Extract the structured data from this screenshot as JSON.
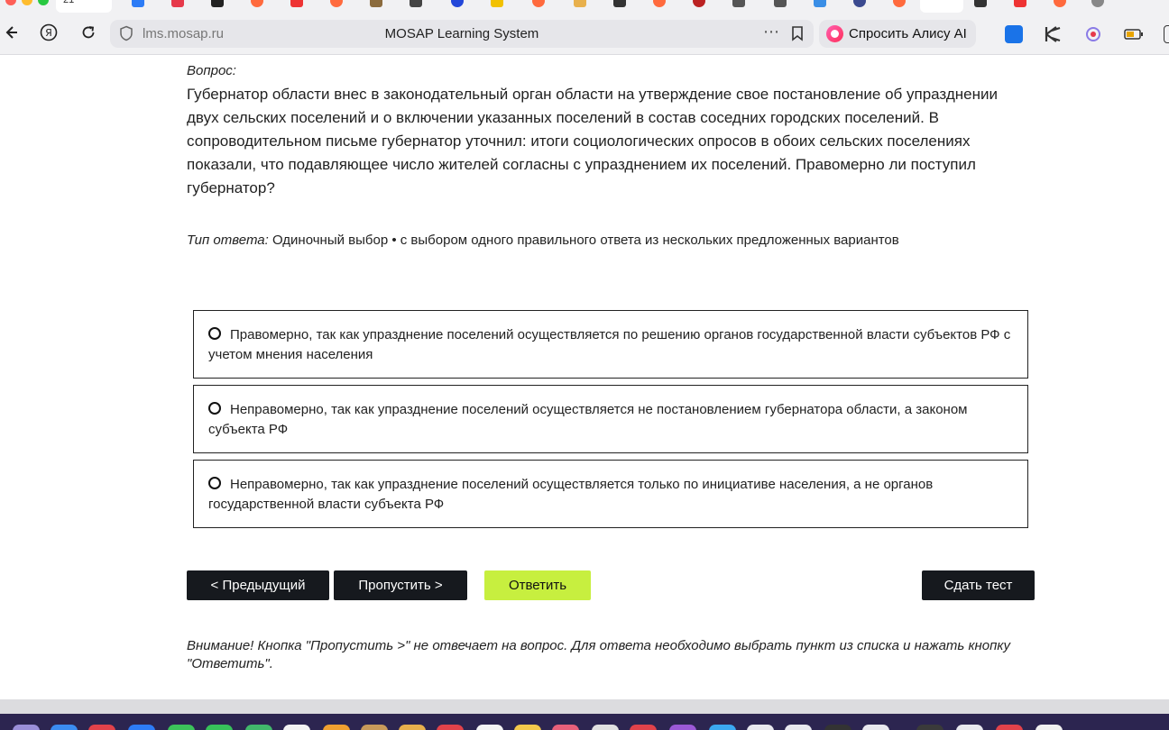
{
  "browser": {
    "url": "lms.mosap.ru",
    "page_title": "MOSAP Learning System",
    "alice_button_label": "Спросить Алису AI",
    "more_icon": "⋯",
    "tab_number": "21"
  },
  "question": {
    "caption": "Вопрос:",
    "text": "Губернатор области внес в законодательный орган области на утверждение свое постановление об упразднении двух сельских поселений и о включении указанных поселений в состав соседних городских поселений. В сопроводительном письме губернатор уточнил: итоги социологических опросов в обоих сельских поселениях показали, что подавляющее число жителей согласны с упразднением их поселений. Правомерно ли поступил губернатор?",
    "answer_type_label": "Тип ответа:",
    "answer_type_value": "Одиночный выбор • с выбором одного правильного ответа из нескольких предложенных вариантов"
  },
  "options": [
    "Правомерно, так как упразднение поселений осуществляется по решению органов государственной власти субъектов РФ с учетом мнения населения",
    "Неправомерно, так как упразднение поселений осуществляется не постановлением губернатора области, а законом субъекта РФ",
    "Неправомерно, так как упразднение поселений осуществляется только по инициативе населения, а не органов государственной власти субъекта РФ"
  ],
  "buttons": {
    "prev": "< Предыдущий",
    "skip": "Пропустить >",
    "answer": "Ответить",
    "submit": "Сдать тест"
  },
  "note": "Внимание! Кнопка \"Пропустить >\" не отвечает на вопрос. Для ответа необходимо выбрать пункт из списка и нажать кнопку \"Ответить\".",
  "colors": {
    "accent_button": "#c7ef3f",
    "dark_button": "#16191e",
    "alice_brand": "#ff2f5a"
  }
}
